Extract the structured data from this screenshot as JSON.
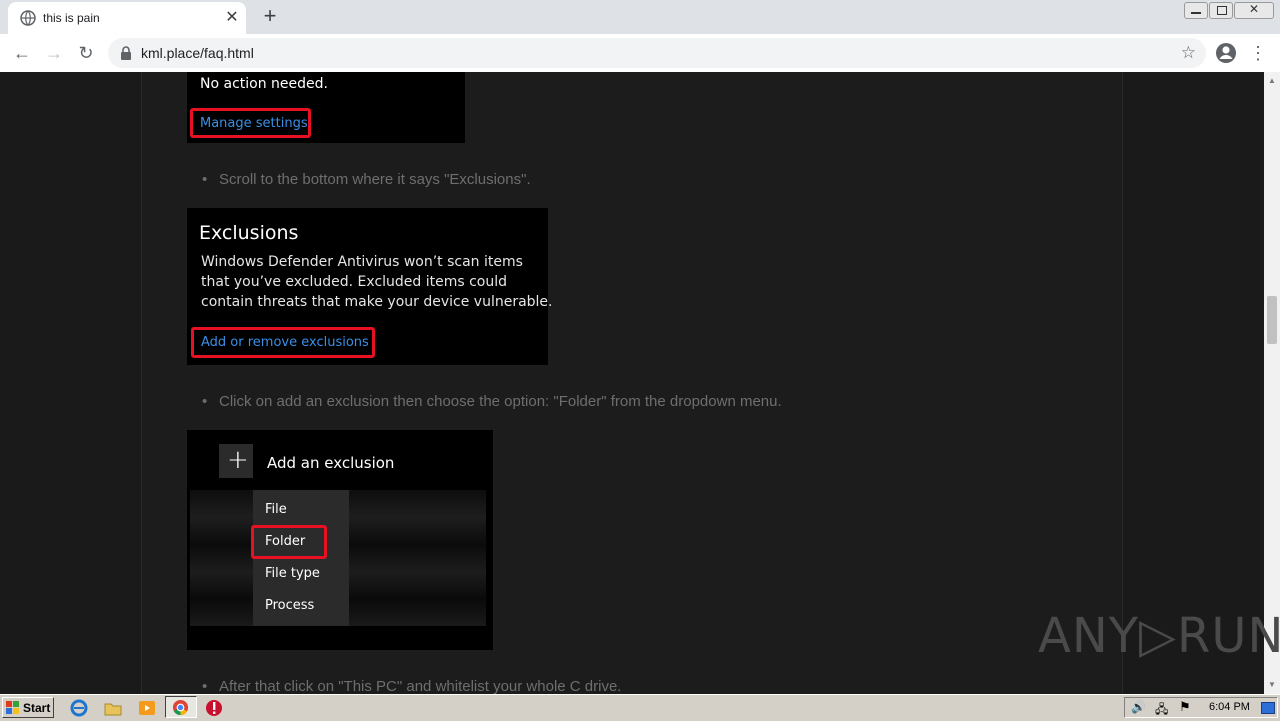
{
  "browser": {
    "tab_title": "this is pain",
    "tab_close": "✕",
    "new_tab": "+",
    "url": "kml.place/faq.html",
    "back": "←",
    "forward": "→",
    "reload": "↻",
    "star": "☆",
    "menu": "⋮"
  },
  "page": {
    "security_card": {
      "status_text": "No action needed.",
      "link_label": "Manage settings"
    },
    "step_scroll": "Scroll to the bottom where it says \"Exclusions\".",
    "exclusions_card": {
      "heading": "Exclusions",
      "body_line_1": "Windows Defender Antivirus won’t scan items",
      "body_line_2": "that you’ve excluded. Excluded items could",
      "body_line_3": "contain threats that make your device vulnerable.",
      "link_label": "Add or remove exclusions"
    },
    "step_folder": "Click on add an exclusion then choose the option: \"Folder\" from the dropdown menu.",
    "exclusion_menu": {
      "add_label": "Add an exclusion",
      "plus": "+",
      "options": [
        "File",
        "Folder",
        "File type",
        "Process"
      ]
    },
    "step_thispc": "After that click on \"This PC\" and whitelist your whole C drive."
  },
  "watermark": "ANY▷RUN",
  "taskbar": {
    "start_label": "Start",
    "clock": "6:04 PM"
  },
  "colors": {
    "highlight_red": "#e81123",
    "link_blue": "#3b8fe6",
    "page_bg": "#1a1a1a"
  }
}
